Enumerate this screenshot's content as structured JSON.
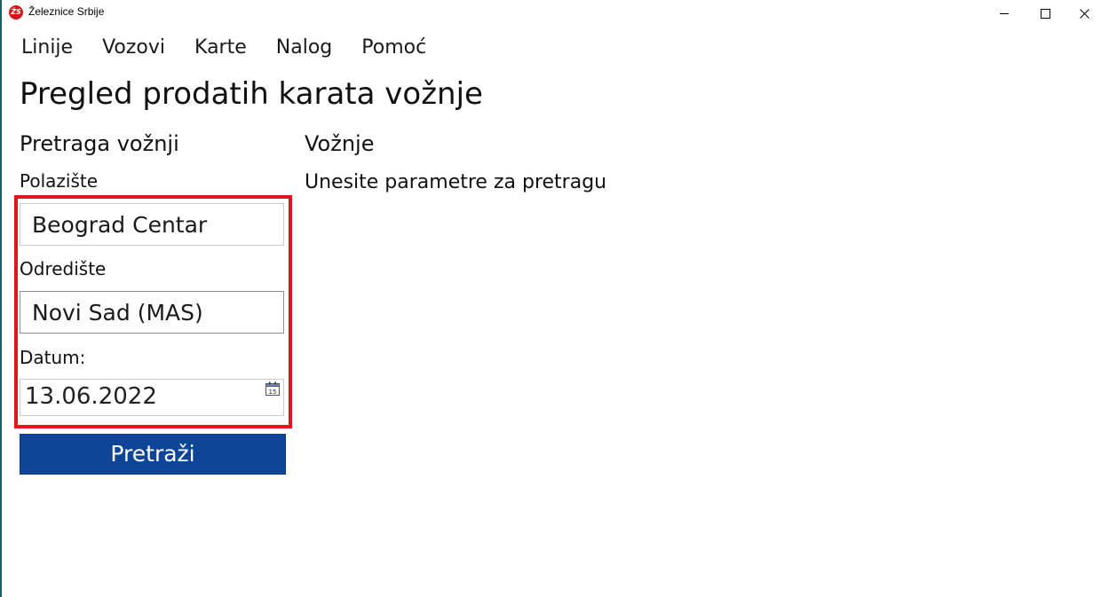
{
  "window": {
    "title": "Železnice Srbije",
    "logo_text": "ŽS",
    "minimize_icon": "minimize-icon",
    "maximize_icon": "maximize-icon",
    "close_icon": "close-icon"
  },
  "menu": {
    "items": [
      {
        "label": "Linije"
      },
      {
        "label": "Vozovi"
      },
      {
        "label": "Karte"
      },
      {
        "label": "Nalog"
      },
      {
        "label": "Pomoć"
      }
    ]
  },
  "page": {
    "title": "Pregled prodatih karata vožnje"
  },
  "search": {
    "heading": "Pretraga vožnji",
    "from_label": "Polazište",
    "from_value": "Beograd Centar",
    "to_label": "Odredište",
    "to_value": "Novi Sad (MAS)",
    "date_label": "Datum:",
    "date_value": "13.06.2022",
    "calendar_icon_day": "15",
    "button_label": "Pretraži"
  },
  "results": {
    "heading": "Vožnje",
    "hint": "Unesite parametre za pretragu"
  },
  "colors": {
    "accent_button": "#0e4596",
    "highlight_border": "#e3141b",
    "logo": "#d7141a",
    "window_edge": "#1b5e66"
  }
}
